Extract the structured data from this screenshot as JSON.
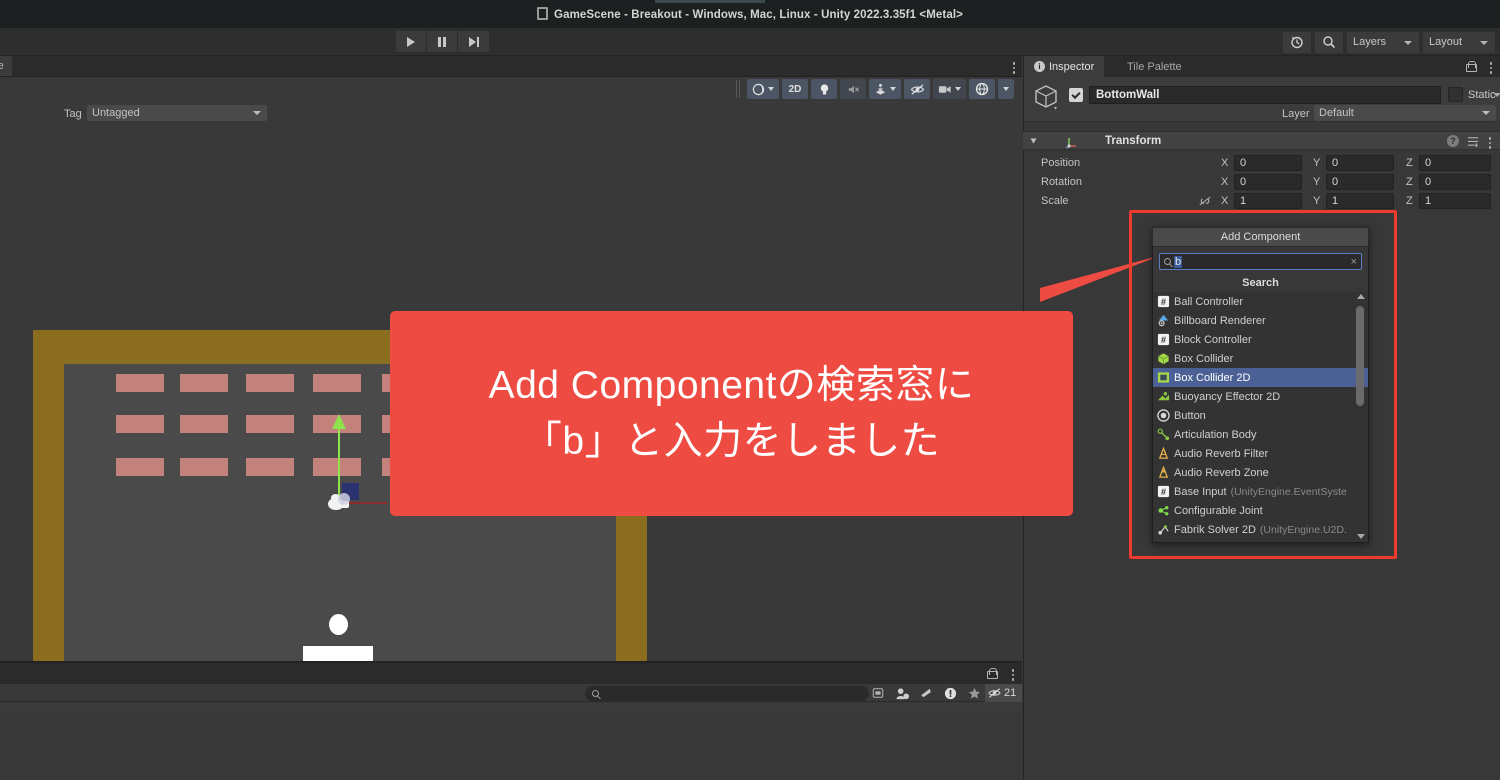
{
  "window": {
    "title": "GameScene - Breakout - Windows, Mac, Linux - Unity 2022.3.35f1 <Metal>",
    "doc_icon": "scene-file-icon"
  },
  "toolbar": {
    "play_label": "play-icon",
    "pause_label": "pause-icon",
    "step_label": "step-icon",
    "history_icon": "undo-history-icon",
    "search_icon": "search-icon",
    "layers_label": "Layers",
    "layout_label": "Layout"
  },
  "scene_panel": {
    "partial_tab_label": "re",
    "toolbar_buttons": [
      {
        "name": "draw-mode-dropdown",
        "label": ""
      },
      {
        "name": "2d-toggle",
        "label": "2D"
      },
      {
        "name": "lighting-toggle",
        "label": ""
      },
      {
        "name": "audio-toggle",
        "label": ""
      },
      {
        "name": "effects-dropdown",
        "label": ""
      },
      {
        "name": "hidden-objects-toggle",
        "label": ""
      },
      {
        "name": "camera-dropdown",
        "label": ""
      },
      {
        "name": "gizmos-dropdown",
        "label": ""
      }
    ]
  },
  "game_scene": {
    "wall_color": "#8a6d1f",
    "play_area_color": "#4a4a4a",
    "block_color": "#c4827c",
    "ball_color": "#ffffff",
    "paddle_color": "#ffffff",
    "block_rows": 3,
    "blocks_per_row": 7,
    "gizmo": {
      "y_axis_color": "#8ee24b",
      "x_axis_color": "#8c2b2b",
      "z_axis_color": "#2b3270"
    }
  },
  "project_panel": {
    "search_placeholder": "",
    "hidden_count": "21",
    "icons": [
      "save-icon",
      "account-icon",
      "warning-icon",
      "error-icon",
      "favorite-icon",
      "hidden-eye-icon"
    ]
  },
  "inspector": {
    "tabs": [
      {
        "label": "Inspector",
        "active": true
      },
      {
        "label": "Tile Palette",
        "active": false
      }
    ],
    "lock_icon": "lock-icon",
    "menu_icon": "kebab-menu-icon",
    "object": {
      "enabled": true,
      "name": "BottomWall",
      "static_label": "Static",
      "tag_label": "Tag",
      "tag_value": "Untagged",
      "layer_label": "Layer",
      "layer_value": "Default"
    },
    "transform": {
      "title": "Transform",
      "rows": [
        {
          "label": "Position",
          "x": "0",
          "y": "0",
          "z": "0"
        },
        {
          "label": "Rotation",
          "x": "0",
          "y": "0",
          "z": "0"
        },
        {
          "label": "Scale",
          "x": "1",
          "y": "1",
          "z": "1"
        }
      ],
      "axis_labels": {
        "x": "X",
        "y": "Y",
        "z": "Z"
      },
      "help_icon": "help-icon",
      "preset_icon": "preset-icon",
      "menu_icon": "kebab-menu-icon"
    }
  },
  "add_component": {
    "button_label": "Add Component",
    "search_value": "b",
    "search_clear_label": "×",
    "search_header": "Search",
    "highlight_color": "#ee3b2e",
    "items": [
      {
        "label": "Ball Controller",
        "sub": "",
        "icon": "script-icon",
        "selected": false
      },
      {
        "label": "Billboard Renderer",
        "sub": "",
        "icon": "billboard-renderer-icon",
        "selected": false
      },
      {
        "label": "Block Controller",
        "sub": "",
        "icon": "script-icon",
        "selected": false
      },
      {
        "label": "Box Collider",
        "sub": "",
        "icon": "box-collider-icon",
        "selected": false
      },
      {
        "label": "Box Collider 2D",
        "sub": "",
        "icon": "box-collider-2d-icon",
        "selected": true
      },
      {
        "label": "Buoyancy Effector 2D",
        "sub": "",
        "icon": "buoyancy-effector-icon",
        "selected": false
      },
      {
        "label": "Button",
        "sub": "",
        "icon": "button-icon",
        "selected": false
      },
      {
        "label": "Articulation Body",
        "sub": "",
        "icon": "articulation-body-icon",
        "selected": false
      },
      {
        "label": "Audio Reverb Filter",
        "sub": "",
        "icon": "audio-filter-icon",
        "selected": false
      },
      {
        "label": "Audio Reverb Zone",
        "sub": "",
        "icon": "audio-zone-icon",
        "selected": false
      },
      {
        "label": "Base Input",
        "sub": "(UnityEngine.EventSyste",
        "icon": "script-icon",
        "selected": false
      },
      {
        "label": "Configurable Joint",
        "sub": "",
        "icon": "joint-icon",
        "selected": false
      },
      {
        "label": "Fabrik Solver 2D",
        "sub": "(UnityEngine.U2D.",
        "icon": "ik-solver-icon",
        "selected": false
      }
    ]
  },
  "callout": {
    "background": "#ee4b42",
    "line1": "Add Componentの検索窓に",
    "line2": "「b」と入力をしました"
  }
}
